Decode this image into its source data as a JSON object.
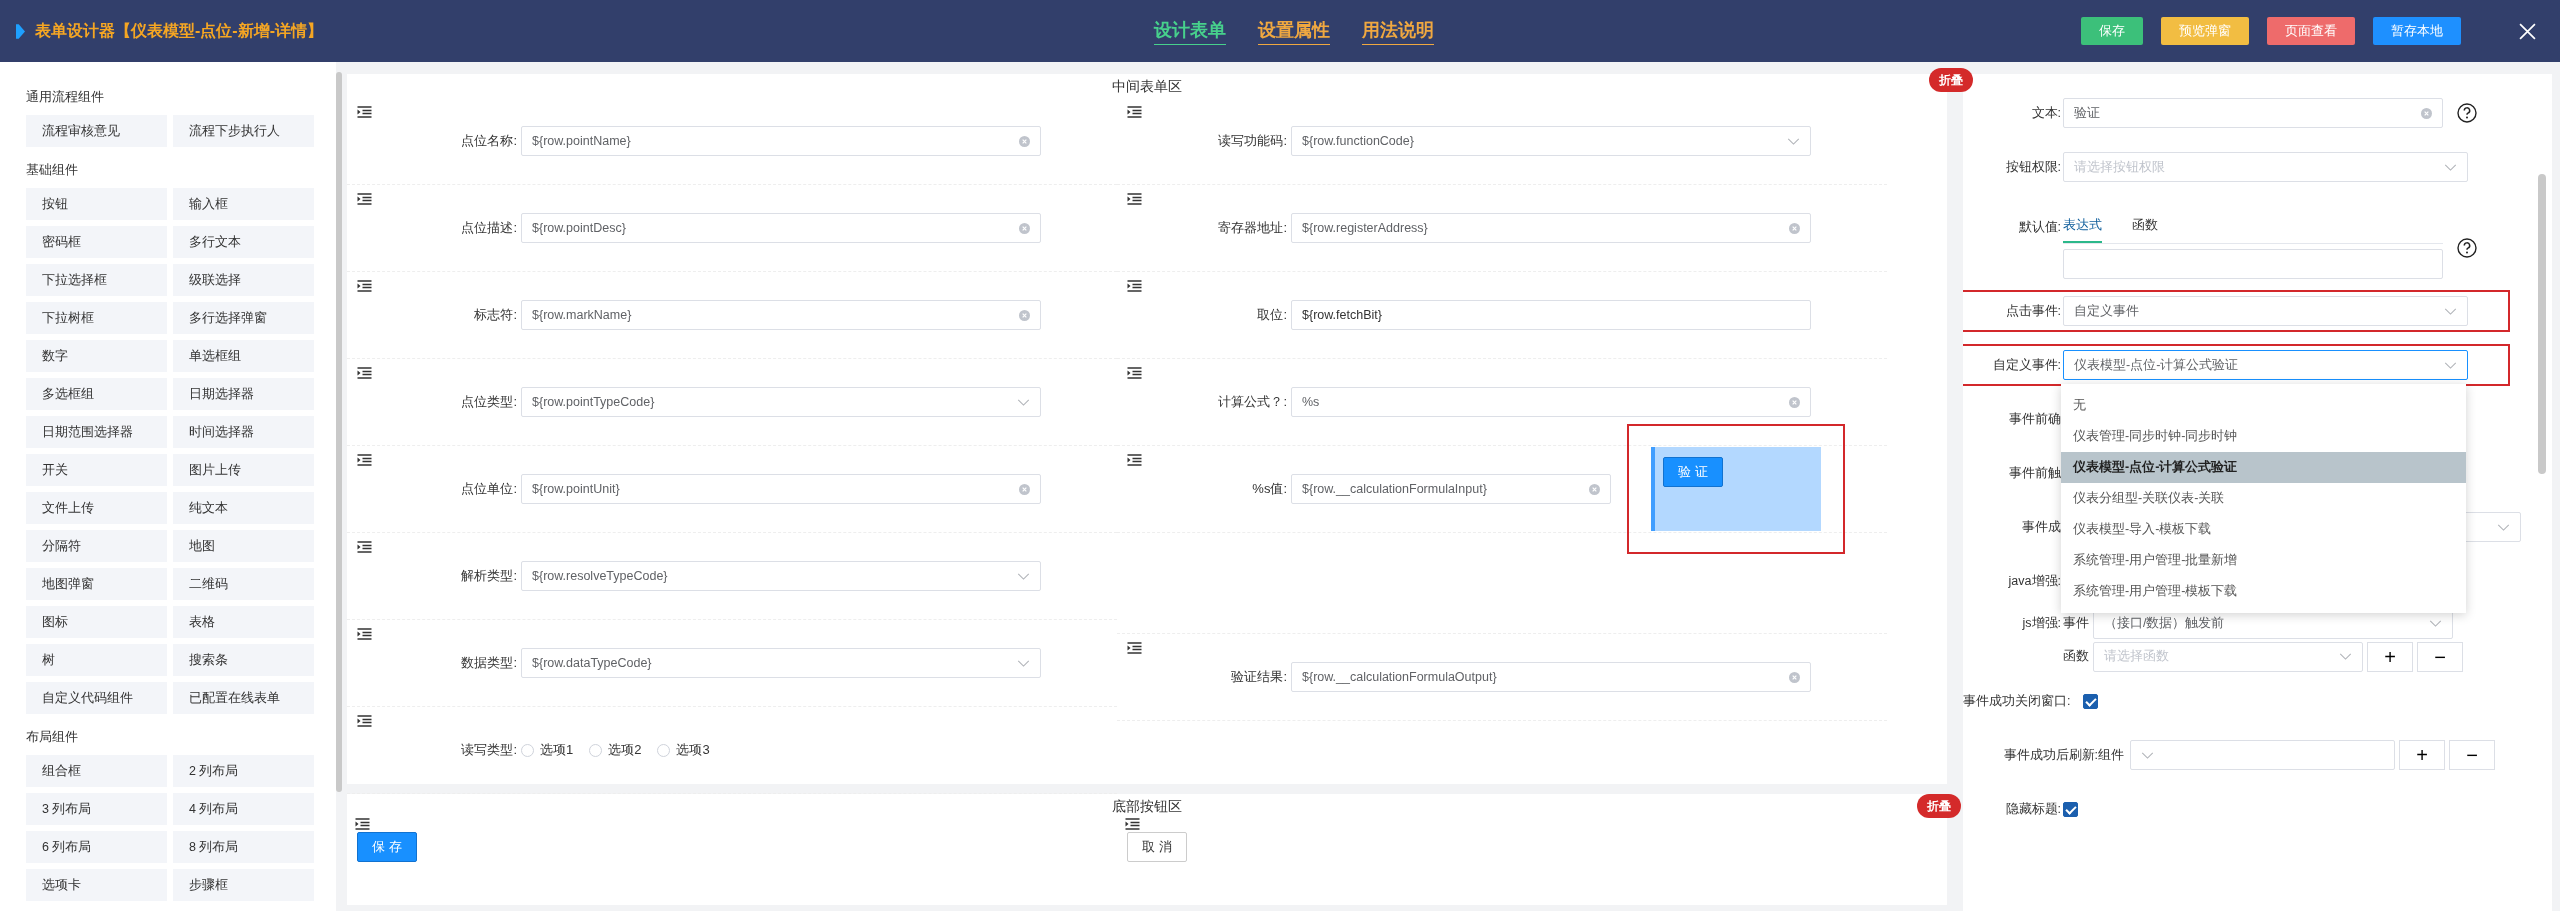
{
  "header": {
    "title": "表单设计器【仪表模型-点位-新增-详情】",
    "tabs": [
      {
        "label": "设计表单",
        "selected": true
      },
      {
        "label": "设置属性",
        "selected": false
      },
      {
        "label": "用法说明",
        "selected": false
      }
    ],
    "buttons": [
      {
        "label": "保存",
        "color": "#3cc07a"
      },
      {
        "label": "预览弹窗",
        "color": "#f2bd42"
      },
      {
        "label": "页面查看",
        "color": "#ee6b6b"
      },
      {
        "label": "暂存本地",
        "color": "#1e90ff"
      }
    ]
  },
  "sidebar": {
    "groups": [
      {
        "title": "通用流程组件",
        "items": [
          "流程审核意见",
          "流程下步执行人"
        ]
      },
      {
        "title": "基础组件",
        "items": [
          "按钮",
          "输入框",
          "密码框",
          "多行文本",
          "下拉选择框",
          "级联选择",
          "下拉树框",
          "多行选择弹窗",
          "数字",
          "单选框组",
          "多选框组",
          "日期选择器",
          "日期范围选择器",
          "时间选择器",
          "开关",
          "图片上传",
          "文件上传",
          "纯文本",
          "分隔符",
          "地图",
          "地图弹窗",
          "二维码",
          "图标",
          "表格",
          "树",
          "搜索条",
          "自定义代码组件",
          "已配置在线表单"
        ]
      },
      {
        "title": "布局组件",
        "items": [
          "组合框",
          "2 列布局",
          "3 列布局",
          "4 列布局",
          "6 列布局",
          "8 列布局",
          "选项卡",
          "步骤框"
        ]
      }
    ]
  },
  "form_area": {
    "title": "中间表单区",
    "collapse": "折叠",
    "left_fields": [
      {
        "label": "点位名称:",
        "kind": "input",
        "value": "${row.pointName}"
      },
      {
        "label": "点位描述:",
        "kind": "input",
        "value": "${row.pointDesc}"
      },
      {
        "label": "标志符:",
        "kind": "input",
        "value": "${row.markName}"
      },
      {
        "label": "点位类型:",
        "kind": "select",
        "value": "${row.pointTypeCode}"
      },
      {
        "label": "点位单位:",
        "kind": "input",
        "value": "${row.pointUnit}"
      },
      {
        "label": "解析类型:",
        "kind": "select",
        "value": "${row.resolveTypeCode}"
      },
      {
        "label": "数据类型:",
        "kind": "select",
        "value": "${row.dataTypeCode}"
      },
      {
        "label": "读写类型:",
        "kind": "radio",
        "options": [
          {
            "label": "选项1",
            "selected": false
          },
          {
            "label": "选项2",
            "selected": false
          },
          {
            "label": "选项3",
            "selected": false
          }
        ]
      }
    ],
    "right_fields": [
      {
        "label": "读写功能码:",
        "kind": "select",
        "value": "${row.functionCode}"
      },
      {
        "label": "寄存器地址:",
        "kind": "input",
        "value": "${row.registerAddress}"
      },
      {
        "label": "取位:",
        "kind": "text",
        "value": "${row.fetchBit}"
      },
      {
        "label": "计算公式？:",
        "kind": "input",
        "value": "%s"
      },
      {
        "label": "%s值:",
        "kind": "input",
        "value": "${row.__calculationFormulaInput}",
        "button": {
          "label": "验 证",
          "selected": true,
          "highlighted": true
        }
      },
      {
        "label": "验证结果:",
        "kind": "input",
        "value": "${row.__calculationFormulaOutput}"
      }
    ]
  },
  "bottom_area": {
    "title": "底部按钮区",
    "collapse": "折叠",
    "buttons": [
      {
        "label": "保 存",
        "kind": "primary"
      },
      {
        "label": "取 消",
        "kind": "default"
      }
    ]
  },
  "properties": {
    "text": {
      "label": "文本:",
      "value": "验证"
    },
    "permission": {
      "label": "按钮权限:",
      "placeholder": "请选择按钮权限"
    },
    "default_value": {
      "label": "默认值:",
      "tabs": [
        {
          "label": "表达式",
          "selected": true
        },
        {
          "label": "函数",
          "selected": false
        }
      ]
    },
    "click_event": {
      "label": "点击事件:",
      "value": "自定义事件",
      "highlighted": true
    },
    "custom_event": {
      "label": "自定义事件:",
      "value": "仪表模型-点位-计算公式验证",
      "highlighted": true,
      "expanded": true,
      "options": [
        {
          "label": "无",
          "selected": false
        },
        {
          "label": "仪表管理-同步时钟-同步时钟",
          "selected": false
        },
        {
          "label": "仪表模型-点位-计算公式验证",
          "selected": true
        },
        {
          "label": "仪表分组型-关联仪表-关联",
          "selected": false
        },
        {
          "label": "仪表模型-导入-模板下载",
          "selected": false
        },
        {
          "label": "系统管理-用户管理-批量新增",
          "selected": false
        },
        {
          "label": "系统管理-用户管理-模板下载",
          "selected": false
        }
      ]
    },
    "covered_labels": [
      "事件前确",
      "事件前触",
      "事件成",
      "java增强:"
    ],
    "js_enhance": {
      "label": "js增强:",
      "event_label": "事件",
      "event_value": "（接口/数据）触发前",
      "function_label": "函数",
      "function_placeholder": "请选择函数",
      "add": "+",
      "remove": "−"
    },
    "close_on_success": {
      "label": "事件成功关闭窗口:",
      "checked": true
    },
    "refresh": {
      "label": "事件成功后刷新:",
      "sub_label": "组件",
      "add": "+",
      "remove": "−"
    },
    "hide_title": {
      "label": "隐藏标题:",
      "checked": true
    }
  }
}
